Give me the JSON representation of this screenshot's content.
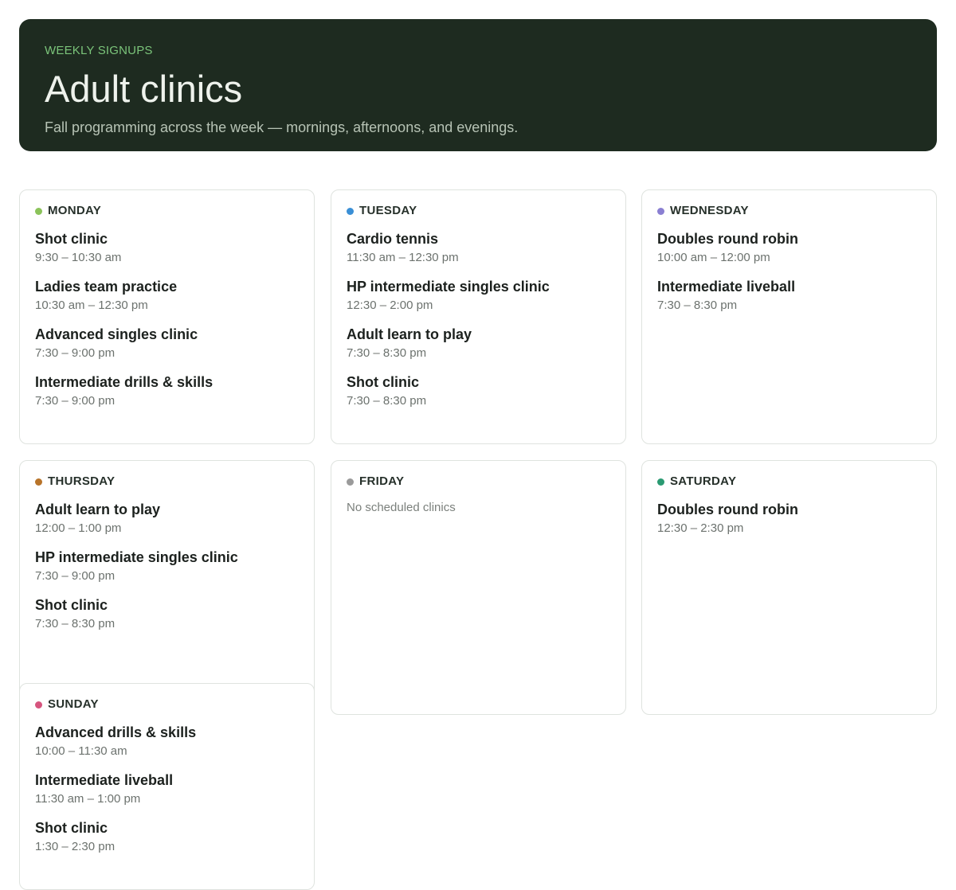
{
  "header": {
    "eyebrow": "WEEKLY SIGNUPS",
    "title": "Adult clinics",
    "subtitle": "Fall programming across the week — mornings, afternoons, and evenings."
  },
  "days": [
    {
      "label": "MONDAY",
      "color": "#8bc35a",
      "sessions": [
        {
          "name": "Shot clinic",
          "time": "9:30 – 10:30 am"
        },
        {
          "name": "Ladies team practice",
          "time": "10:30 am – 12:30 pm"
        },
        {
          "name": "Advanced singles clinic",
          "time": "7:30 – 9:00 pm"
        },
        {
          "name": "Intermediate drills & skills",
          "time": "7:30 – 9:00 pm"
        }
      ]
    },
    {
      "label": "TUESDAY",
      "color": "#3a8fd6",
      "sessions": [
        {
          "name": "Cardio tennis",
          "time": "11:30 am – 12:30 pm"
        },
        {
          "name": "HP intermediate singles clinic",
          "time": "12:30 – 2:00 pm"
        },
        {
          "name": "Adult learn to play",
          "time": "7:30 – 8:30 pm"
        },
        {
          "name": "Shot clinic",
          "time": "7:30 – 8:30 pm"
        }
      ]
    },
    {
      "label": "WEDNESDAY",
      "color": "#8a7fd2",
      "sessions": [
        {
          "name": "Doubles round robin",
          "time": "10:00 am – 12:00 pm"
        },
        {
          "name": "Intermediate liveball",
          "time": "7:30 – 8:30 pm"
        }
      ]
    },
    {
      "label": "THURSDAY",
      "color": "#b8742a",
      "sessions": [
        {
          "name": "Adult learn to play",
          "time": "12:00 – 1:00 pm"
        },
        {
          "name": "HP intermediate singles clinic",
          "time": "7:30 – 9:00 pm"
        },
        {
          "name": "Shot clinic",
          "time": "7:30 – 8:30 pm"
        }
      ]
    },
    {
      "label": "FRIDAY",
      "color": "#9a9a9a",
      "sessions": [],
      "empty_text": "No scheduled clinics"
    },
    {
      "label": "SATURDAY",
      "color": "#2a9a72",
      "sessions": [
        {
          "name": "Doubles round robin",
          "time": "12:30 – 2:30 pm"
        }
      ]
    },
    {
      "label": "SUNDAY",
      "color": "#d6557e",
      "sessions": [
        {
          "name": "Advanced drills & skills",
          "time": "10:00 – 11:30 am"
        },
        {
          "name": "Intermediate liveball",
          "time": "11:30 am – 1:00 pm"
        },
        {
          "name": "Shot clinic",
          "time": "1:30 – 2:30 pm"
        }
      ]
    }
  ]
}
